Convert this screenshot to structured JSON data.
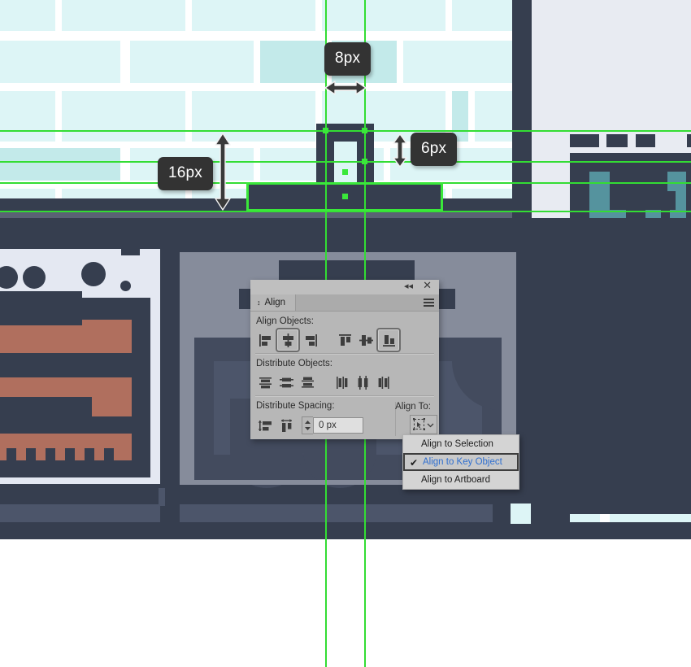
{
  "app": {
    "type": "vector-graphics-editor",
    "panel": {
      "title": "Align",
      "topbar": {
        "collapse_icon": "double-chevron-left-icon",
        "close_icon": "close-icon"
      },
      "menu_icon": "hamburger-menu-icon",
      "tab_icon": "double-chevron-vertical-icon",
      "sections": [
        {
          "label": "Align Objects:",
          "buttons": [
            {
              "name": "horizontal-align-left",
              "selected": false
            },
            {
              "name": "horizontal-align-center",
              "selected": true
            },
            {
              "name": "horizontal-align-right",
              "selected": false
            },
            {
              "name": "vertical-align-top",
              "selected": false
            },
            {
              "name": "vertical-align-center",
              "selected": false
            },
            {
              "name": "vertical-align-bottom",
              "selected": true
            }
          ]
        },
        {
          "label": "Distribute Objects:",
          "buttons": [
            {
              "name": "vertical-distribute-top",
              "selected": false
            },
            {
              "name": "vertical-distribute-center",
              "selected": false
            },
            {
              "name": "vertical-distribute-bottom",
              "selected": false
            },
            {
              "name": "horizontal-distribute-left",
              "selected": false
            },
            {
              "name": "horizontal-distribute-center",
              "selected": false
            },
            {
              "name": "horizontal-distribute-right",
              "selected": false
            }
          ]
        }
      ],
      "spacing": {
        "label": "Distribute Spacing:",
        "buttons": [
          {
            "name": "vertical-distribute-spacing",
            "selected": false
          },
          {
            "name": "horizontal-distribute-spacing",
            "selected": false
          }
        ],
        "value": "0 px",
        "placeholder": "0 px",
        "stepper_icon": "stepper-up-down-icon"
      },
      "align_to": {
        "label": "Align To:",
        "button_icon": "align-to-key-object-icon",
        "chevron_icon": "chevron-down-icon"
      }
    },
    "dropdown": {
      "items": [
        {
          "label": "Align to Selection",
          "checked": false,
          "highlighted": false
        },
        {
          "label": "Align to Key Object",
          "checked": true,
          "highlighted": true
        },
        {
          "label": "Align to Artboard",
          "checked": false,
          "highlighted": false
        }
      ],
      "check_glyph": "✔"
    }
  },
  "measurements": [
    {
      "id": "m-8px",
      "label": "8px",
      "orientation": "horizontal",
      "arrow": "double-arrow-horizontal-icon"
    },
    {
      "id": "m-6px",
      "label": "6px",
      "orientation": "vertical",
      "arrow": "double-arrow-vertical-icon"
    },
    {
      "id": "m-16px",
      "label": "16px",
      "orientation": "vertical",
      "arrow": "double-arrow-vertical-icon"
    }
  ],
  "colors": {
    "guide_green": "#33dd33",
    "selection_green": "#3ae83a",
    "tooltip_bg": "#333333",
    "tooltip_text": "#ffffff",
    "panel_bg": "#b7b7b7",
    "menu_bg": "#d4d4d4",
    "menu_highlight_text": "#2f6fd0",
    "canvas_bg": "#e8ebf2",
    "navy": "#363e4f",
    "slate": "#4c556a",
    "grey_block": "#868c9b",
    "brick_light": "#ddf5f6",
    "brick_mid": "#c3eaea",
    "teal": "#55939e",
    "terracotta": "#b06f5e",
    "white": "#ffffff"
  }
}
